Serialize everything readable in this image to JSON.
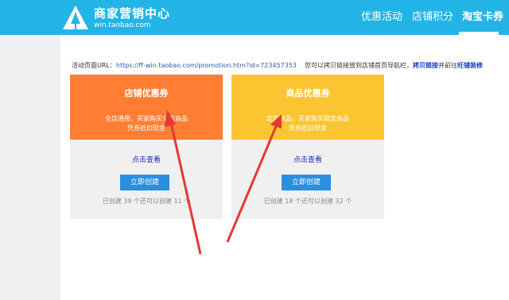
{
  "header": {
    "brand_title": "商家营销中心",
    "brand_subtitle": "win.taobao.com",
    "nav": [
      "优惠活动",
      "店铺积分",
      "淘宝卡券"
    ],
    "active_nav": "淘宝卡券",
    "bg_color": "#22b4e6"
  },
  "urlbar": {
    "label": "活动页面URL：",
    "url": "https://ff-win.taobao.com/promotion.htm?id=723457353",
    "hint": "您可以拷贝链接放到店铺首页导航栏，",
    "link1": "拷贝链接",
    "mid": "并前往",
    "link2": "旺铺装修"
  },
  "cards": [
    {
      "title": "店铺优惠券",
      "desc1": "全店通用，买家购买全店商品",
      "desc2": "凭券抵扣现金",
      "view": "点击查看",
      "button": "立即创建",
      "count": "已创建 39 个还可以创建 11 个",
      "color": "#ff7e33"
    },
    {
      "title": "商品优惠券",
      "desc1": "定向商品，买家购买限定商品",
      "desc2": "凭券抵扣现金",
      "view": "点击查看",
      "button": "立即创建",
      "count": "已创建 18 个还可以创建 32 个",
      "color": "#fbc531"
    }
  ]
}
